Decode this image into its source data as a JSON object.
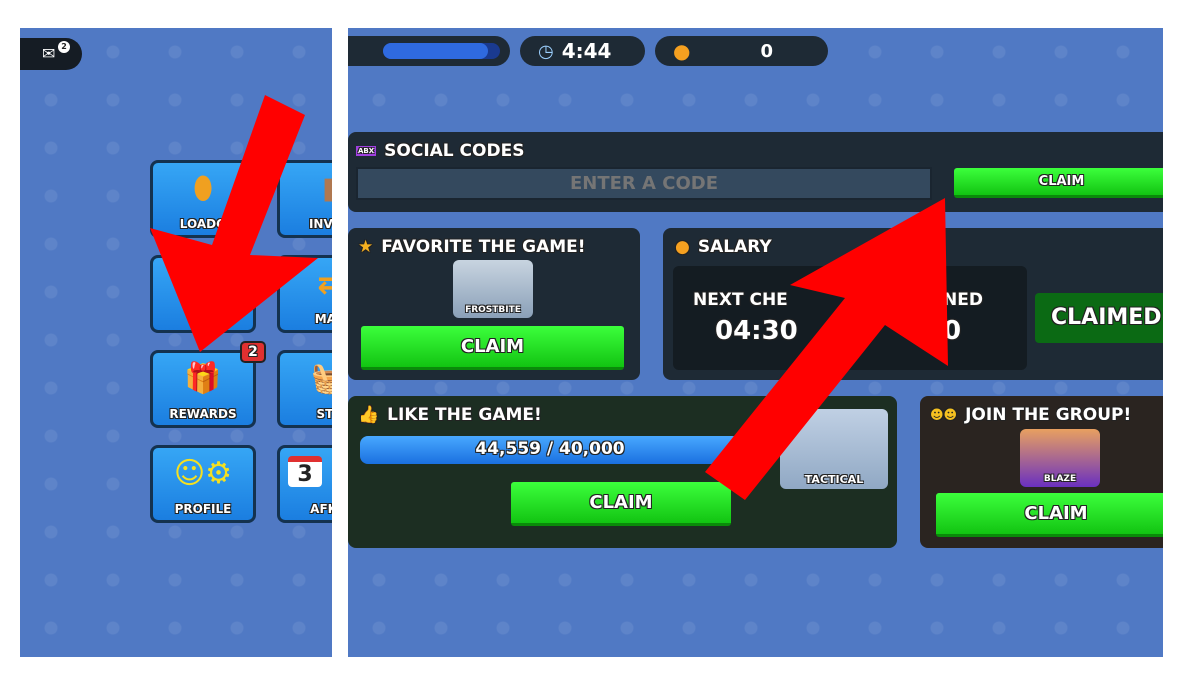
{
  "left": {
    "notification_count": "2",
    "tiles": [
      {
        "label": "LOADO",
        "icon": "bullet-icon"
      },
      {
        "label": "INVEN",
        "icon": "backpack-icon"
      },
      {
        "label": "C",
        "icon": "case-icon"
      },
      {
        "label": "MAR",
        "icon": "market-icon"
      },
      {
        "label": "REWARDS",
        "icon": "gift-icon",
        "badge": "2"
      },
      {
        "label": "STO",
        "icon": "basket-icon"
      },
      {
        "label": "PROFILE",
        "icon": "profile-gear-icon"
      },
      {
        "label": "AFK Z",
        "icon": "calendar-icon",
        "calendar_day": "3"
      }
    ]
  },
  "topbar": {
    "timer": "4:44",
    "coins": "0",
    "progress": 0.9
  },
  "social_codes": {
    "title": "SOCIAL CODES",
    "placeholder": "ENTER A CODE",
    "claim": "CLAIM"
  },
  "favorite": {
    "title": "FAVORITE THE GAME!",
    "item": "FROSTBITE",
    "claim": "CLAIM"
  },
  "salary": {
    "title": "SALARY",
    "next_label": "NEXT CHE",
    "next_value": "04:30",
    "earned_label": "NED",
    "earned_value": "0",
    "claimed": "CLAIMED"
  },
  "like": {
    "title": "LIKE THE GAME!",
    "progress_text": "44,559 / 40,000",
    "progress": 1.0,
    "item": "TACTICAL",
    "claim": "CLAIM"
  },
  "group": {
    "title": "JOIN THE GROUP!",
    "item": "BLAZE",
    "claim": "CLAIM"
  },
  "colors": {
    "arrow": "#ff0000",
    "claim_green": "#22dd22",
    "panel_blue": "#5079c4"
  }
}
